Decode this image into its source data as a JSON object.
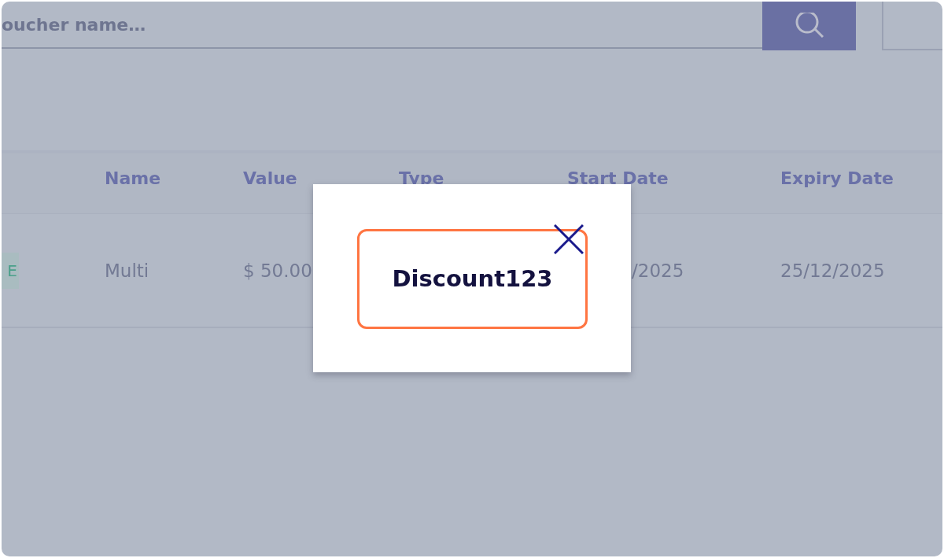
{
  "search": {
    "placeholder": "oucher name…"
  },
  "table": {
    "columns": [
      "Name",
      "Value",
      "Type",
      "Start Date",
      "Expiry Date"
    ],
    "rows": [
      {
        "tag": "E",
        "cells": [
          "Multi",
          "$ 50.00",
          "",
          "/2025",
          "25/12/2025"
        ]
      }
    ]
  },
  "modal": {
    "code": "Discount123"
  }
}
